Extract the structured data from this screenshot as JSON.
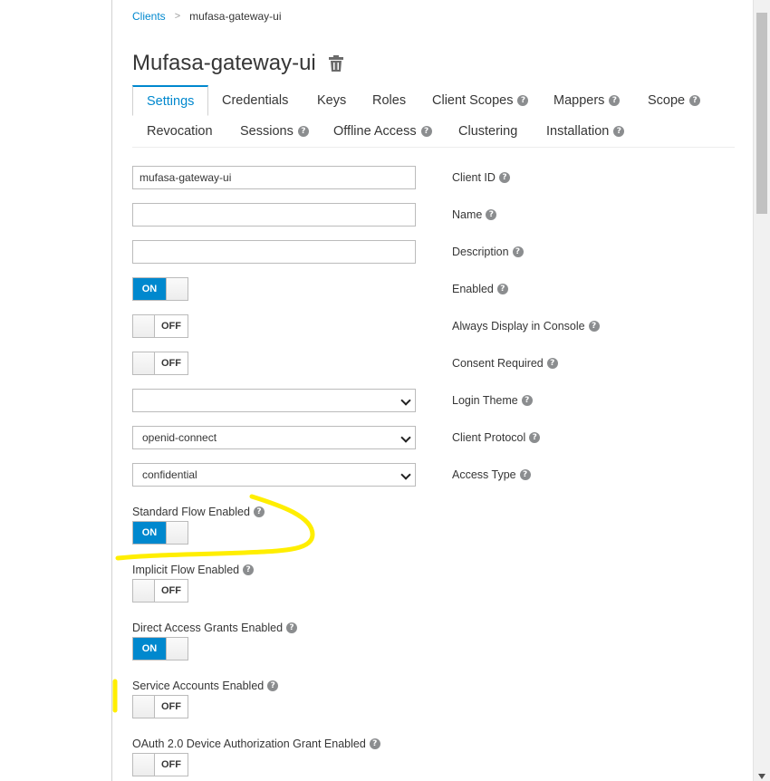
{
  "breadcrumb": {
    "parent": "Clients",
    "current": "mufasa-gateway-ui"
  },
  "title": "Mufasa-gateway-ui",
  "tabs": [
    {
      "label": "Settings",
      "help": false
    },
    {
      "label": "Credentials",
      "help": false
    },
    {
      "label": "Keys",
      "help": false
    },
    {
      "label": "Roles",
      "help": false
    },
    {
      "label": "Client Scopes",
      "help": true
    },
    {
      "label": "Mappers",
      "help": true
    },
    {
      "label": "Scope",
      "help": true
    },
    {
      "label": "Revocation",
      "help": false
    },
    {
      "label": "Sessions",
      "help": true
    },
    {
      "label": "Offline Access",
      "help": true
    },
    {
      "label": "Clustering",
      "help": false
    },
    {
      "label": "Installation",
      "help": true
    }
  ],
  "fields": {
    "client_id": {
      "label": "Client ID",
      "value": "mufasa-gateway-ui"
    },
    "name": {
      "label": "Name",
      "value": ""
    },
    "description": {
      "label": "Description",
      "value": ""
    },
    "enabled": {
      "label": "Enabled",
      "state": "ON"
    },
    "always_display": {
      "label": "Always Display in Console",
      "state": "OFF"
    },
    "consent_required": {
      "label": "Consent Required",
      "state": "OFF"
    },
    "login_theme": {
      "label": "Login Theme",
      "value": ""
    },
    "client_protocol": {
      "label": "Client Protocol",
      "value": "openid-connect"
    },
    "access_type": {
      "label": "Access Type",
      "value": "confidential"
    },
    "standard_flow": {
      "label": "Standard Flow Enabled",
      "state": "ON"
    },
    "implicit_flow": {
      "label": "Implicit Flow Enabled",
      "state": "OFF"
    },
    "direct_access": {
      "label": "Direct Access Grants Enabled",
      "state": "ON"
    },
    "service_accounts": {
      "label": "Service Accounts Enabled",
      "state": "OFF"
    },
    "device_grant": {
      "label": "OAuth 2.0 Device Authorization Grant Enabled",
      "state": "OFF"
    }
  },
  "colors": {
    "accent": "#0088ce",
    "highlight": "#ffee00"
  },
  "help_glyph": "?"
}
